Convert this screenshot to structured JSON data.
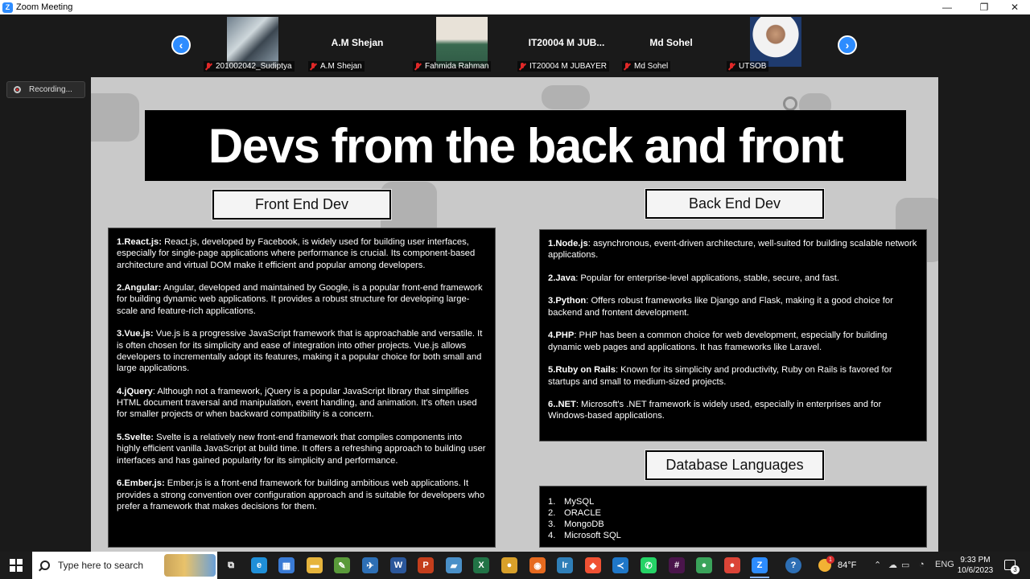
{
  "window": {
    "title": "Zoom Meeting",
    "minimize": "—",
    "maximize": "❐",
    "close": "✕"
  },
  "gallery": {
    "prev": "‹",
    "next": "›",
    "participants": [
      {
        "label": "201002042_Sudiptya",
        "display": "photo",
        "name_center": ""
      },
      {
        "label": "A.M Shejan",
        "display": "name",
        "name_center": "A.M Shejan"
      },
      {
        "label": "Fahmida Rahman",
        "display": "photo",
        "name_center": ""
      },
      {
        "label": "IT20004 M JUBAYER",
        "display": "name",
        "name_center": "IT20004 M JUB..."
      },
      {
        "label": "Md Sohel",
        "display": "name",
        "name_center": "Md Sohel"
      },
      {
        "label": "UTSOB",
        "display": "photo",
        "name_center": ""
      }
    ]
  },
  "recording": {
    "label": "Recording..."
  },
  "slide": {
    "title": "Devs from the back and front",
    "front": {
      "header": "Front End Dev",
      "items": [
        {
          "name": "1.React.js:",
          "text": " React.js, developed by Facebook, is widely used for building user interfaces, especially for single-page applications where performance is crucial. Its component-based architecture and virtual DOM make it efficient and popular among developers."
        },
        {
          "name": "2.Angular:",
          "text": " Angular, developed and maintained by Google, is a popular front-end framework for building dynamic web applications. It provides a robust structure for developing large-scale and feature-rich applications."
        },
        {
          "name": "3.Vue.js:",
          "text": " Vue.js is a progressive JavaScript framework that is approachable and versatile. It is often chosen for its simplicity and ease of integration into other projects. Vue.js allows developers to incrementally adopt its features, making it a popular choice for both small and large applications."
        },
        {
          "name": "4.jQuery",
          "text": ": Although not a framework, jQuery is a popular JavaScript library that simplifies HTML document traversal and manipulation, event handling, and animation. It's often used for smaller projects or when backward compatibility is a concern."
        },
        {
          "name": "5.Svelte:",
          "text": " Svelte is a relatively new front-end framework that compiles components into highly efficient vanilla JavaScript at build time. It offers a refreshing approach to building user interfaces and has gained popularity for its simplicity and performance."
        },
        {
          "name": "6.Ember.js:",
          "text": " Ember.js is a front-end framework for building ambitious web applications. It provides a strong convention over configuration approach and is suitable for developers who prefer a framework that makes decisions for them."
        }
      ]
    },
    "back": {
      "header": "Back End Dev",
      "items": [
        {
          "name": "1.Node.js",
          "text": ": asynchronous, event-driven architecture, well-suited for building scalable network applications."
        },
        {
          "name": "2.Java",
          "text": ": Popular for enterprise-level applications, stable, secure, and fast."
        },
        {
          "name": "3.Python",
          "text": ": Offers robust frameworks like Django and Flask, making it a good choice for backend and frontent development."
        },
        {
          "name": "4.PHP",
          "text": ": PHP has been a common choice for web development, especially for building dynamic web pages and applications. It has frameworks like Laravel."
        },
        {
          "name": "5.Ruby on Rails",
          "text": ": Known for its simplicity and productivity, Ruby on Rails is favored for startups and small to medium-sized projects."
        },
        {
          "name": "6..NET",
          "text": ": Microsoft's .NET framework is widely used, especially in enterprises and for Windows-based applications."
        }
      ]
    },
    "database": {
      "header": "Database Languages",
      "items": [
        {
          "num": "1.",
          "name": "MySQL"
        },
        {
          "num": "2.",
          "name": "ORACLE"
        },
        {
          "num": "3.",
          "name": "MongoDB"
        },
        {
          "num": "4.",
          "name": "Microsoft SQL"
        }
      ]
    }
  },
  "taskbar": {
    "search_placeholder": "Type here to search",
    "apps": [
      {
        "icon": "task-view-icon",
        "glyph": "⧉",
        "color": "#1c1c1c"
      },
      {
        "icon": "edge-icon",
        "glyph": "e",
        "color": "#1f8fd8"
      },
      {
        "icon": "store-icon",
        "glyph": "▦",
        "color": "#3a7bd5"
      },
      {
        "icon": "file-explorer-icon",
        "glyph": "▬",
        "color": "#e6b43c"
      },
      {
        "icon": "sticky-icon",
        "glyph": "✎",
        "color": "#5a9a3a"
      },
      {
        "icon": "photos-icon",
        "glyph": "✈",
        "color": "#2d6fb5"
      },
      {
        "icon": "word-icon",
        "glyph": "W",
        "color": "#2b579a"
      },
      {
        "icon": "powerpoint-icon",
        "glyph": "P",
        "color": "#c43e1c"
      },
      {
        "icon": "files-icon",
        "glyph": "▰",
        "color": "#4a90c8"
      },
      {
        "icon": "excel-icon",
        "glyph": "X",
        "color": "#217346"
      },
      {
        "icon": "chrome-icon",
        "glyph": "●",
        "color": "#d8a02a"
      },
      {
        "icon": "firefox-icon",
        "glyph": "◉",
        "color": "#e66a1f"
      },
      {
        "icon": "app-icon",
        "glyph": "Ir",
        "color": "#2f7fb8"
      },
      {
        "icon": "git-icon",
        "glyph": "◆",
        "color": "#f05133"
      },
      {
        "icon": "vscode-icon",
        "glyph": "≺",
        "color": "#1f77c8"
      },
      {
        "icon": "whatsapp-icon",
        "glyph": "✆",
        "color": "#25d366"
      },
      {
        "icon": "slack-icon",
        "glyph": "#",
        "color": "#4a154b"
      },
      {
        "icon": "chrome-2-icon",
        "glyph": "●",
        "color": "#3aa35a"
      },
      {
        "icon": "chrome-3-icon",
        "glyph": "●",
        "color": "#db4437"
      },
      {
        "icon": "zoom-icon",
        "glyph": "Z",
        "color": "#2d8cff"
      }
    ],
    "help_glyph": "?",
    "temperature": "84°F",
    "language": "ENG",
    "time": "9:33 PM",
    "date": "10/6/2023"
  }
}
